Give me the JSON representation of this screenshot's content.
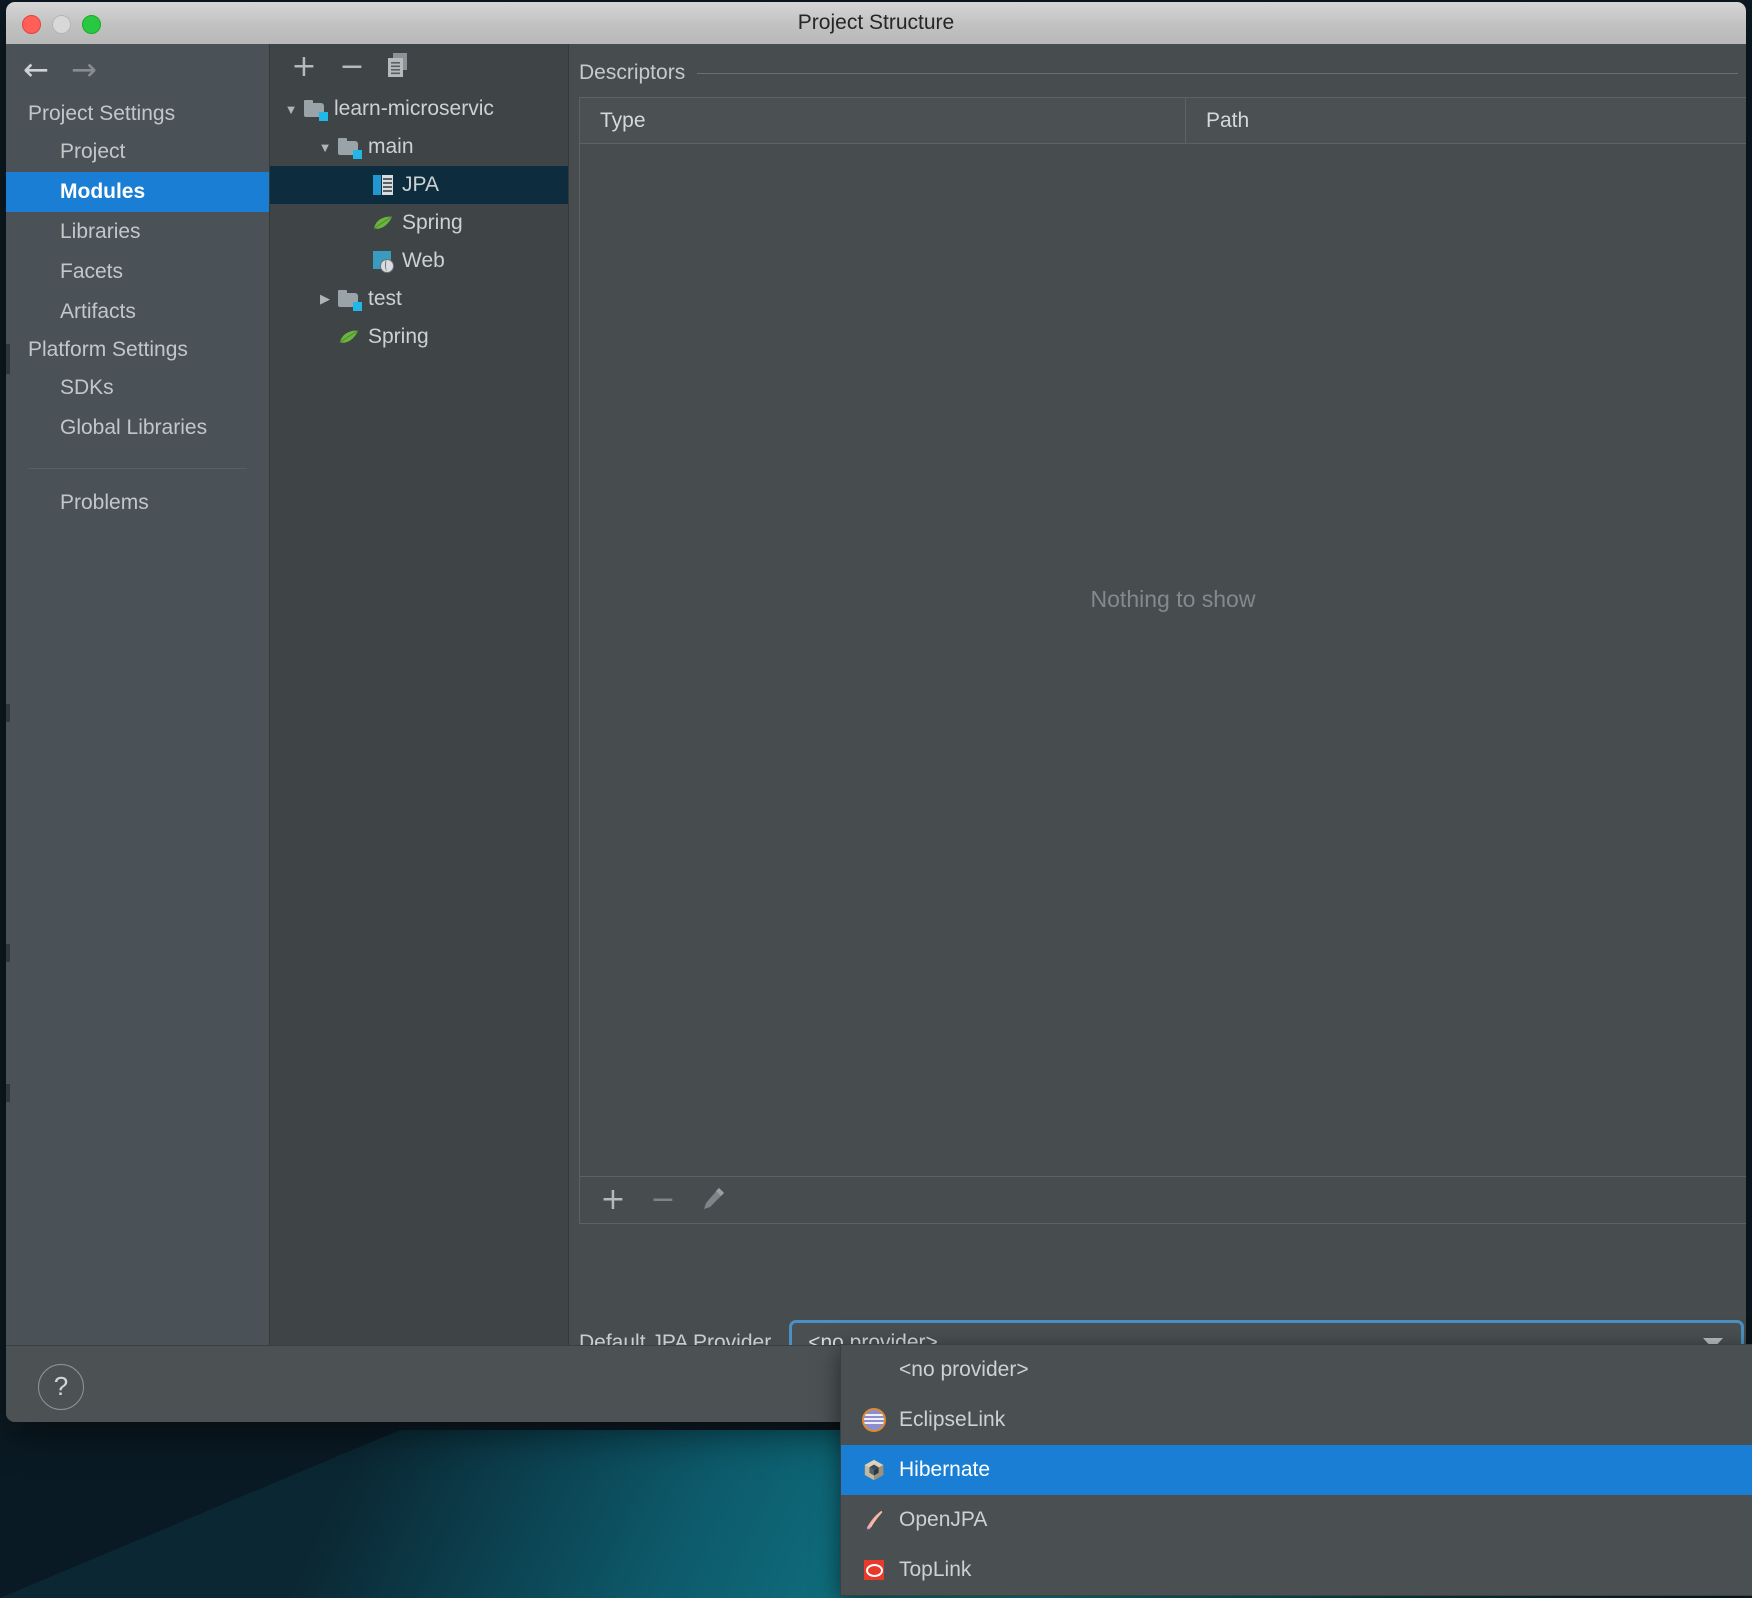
{
  "window": {
    "title": "Project Structure",
    "traffic_lights": [
      "close",
      "minimize",
      "zoom"
    ]
  },
  "nav": {
    "back_icon": "arrow-left-icon",
    "forward_icon": "arrow-right-icon"
  },
  "sidebar": {
    "groups": [
      {
        "label": "Project Settings",
        "items": [
          {
            "label": "Project",
            "selected": false
          },
          {
            "label": "Modules",
            "selected": true
          },
          {
            "label": "Libraries",
            "selected": false
          },
          {
            "label": "Facets",
            "selected": false
          },
          {
            "label": "Artifacts",
            "selected": false
          }
        ]
      },
      {
        "label": "Platform Settings",
        "items": [
          {
            "label": "SDKs",
            "selected": false
          },
          {
            "label": "Global Libraries",
            "selected": false
          }
        ]
      }
    ],
    "extra_items": [
      {
        "label": "Problems",
        "selected": false
      }
    ]
  },
  "tree_toolbar": {
    "add_label": "+",
    "remove_label": "−",
    "copy_icon": "copy-icon"
  },
  "tree": {
    "rows": [
      {
        "label": "learn-microservic",
        "icon": "module-folder-icon",
        "twisty": "▼",
        "indent": 0,
        "selected": false
      },
      {
        "label": "main",
        "icon": "module-folder-icon",
        "twisty": "▼",
        "indent": 1,
        "selected": false
      },
      {
        "label": "JPA",
        "icon": "jpa-facet-icon",
        "twisty": "",
        "indent": 2,
        "selected": true
      },
      {
        "label": "Spring",
        "icon": "spring-facet-icon",
        "twisty": "",
        "indent": 2,
        "selected": false
      },
      {
        "label": "Web",
        "icon": "web-facet-icon",
        "twisty": "",
        "indent": 2,
        "selected": false
      },
      {
        "label": "test",
        "icon": "module-folder-icon",
        "twisty": "▶",
        "indent": 1,
        "selected": false
      },
      {
        "label": "Spring",
        "icon": "spring-facet-icon",
        "twisty": "",
        "indent": 2,
        "selected": false
      }
    ]
  },
  "content": {
    "legend": "Descriptors",
    "table": {
      "columns": [
        "Type",
        "Path"
      ],
      "rows": [],
      "empty_text": "Nothing to show"
    },
    "table_toolbar": {
      "add_label": "+",
      "remove_label": "−",
      "edit_icon": "pencil-icon"
    }
  },
  "provider": {
    "label": "Default JPA Provider",
    "value": "<no provider>",
    "arrow_icon": "chevron-down-icon",
    "options": [
      {
        "label": "<no provider>",
        "icon": "none",
        "selected": false
      },
      {
        "label": "EclipseLink",
        "icon": "eclipselink-icon",
        "selected": false
      },
      {
        "label": "Hibernate",
        "icon": "hibernate-icon",
        "selected": true
      },
      {
        "label": "OpenJPA",
        "icon": "openjpa-icon",
        "selected": false
      },
      {
        "label": "TopLink",
        "icon": "toplink-icon",
        "selected": false
      }
    ]
  },
  "footer": {
    "help_label": "?"
  },
  "colors": {
    "accent_blue": "#1a7fd4",
    "selection_tree": "#0d2c3e",
    "focus_border": "#4a90c4",
    "panel_bg": "#474c4e",
    "sidebar_bg": "#4a5157"
  }
}
